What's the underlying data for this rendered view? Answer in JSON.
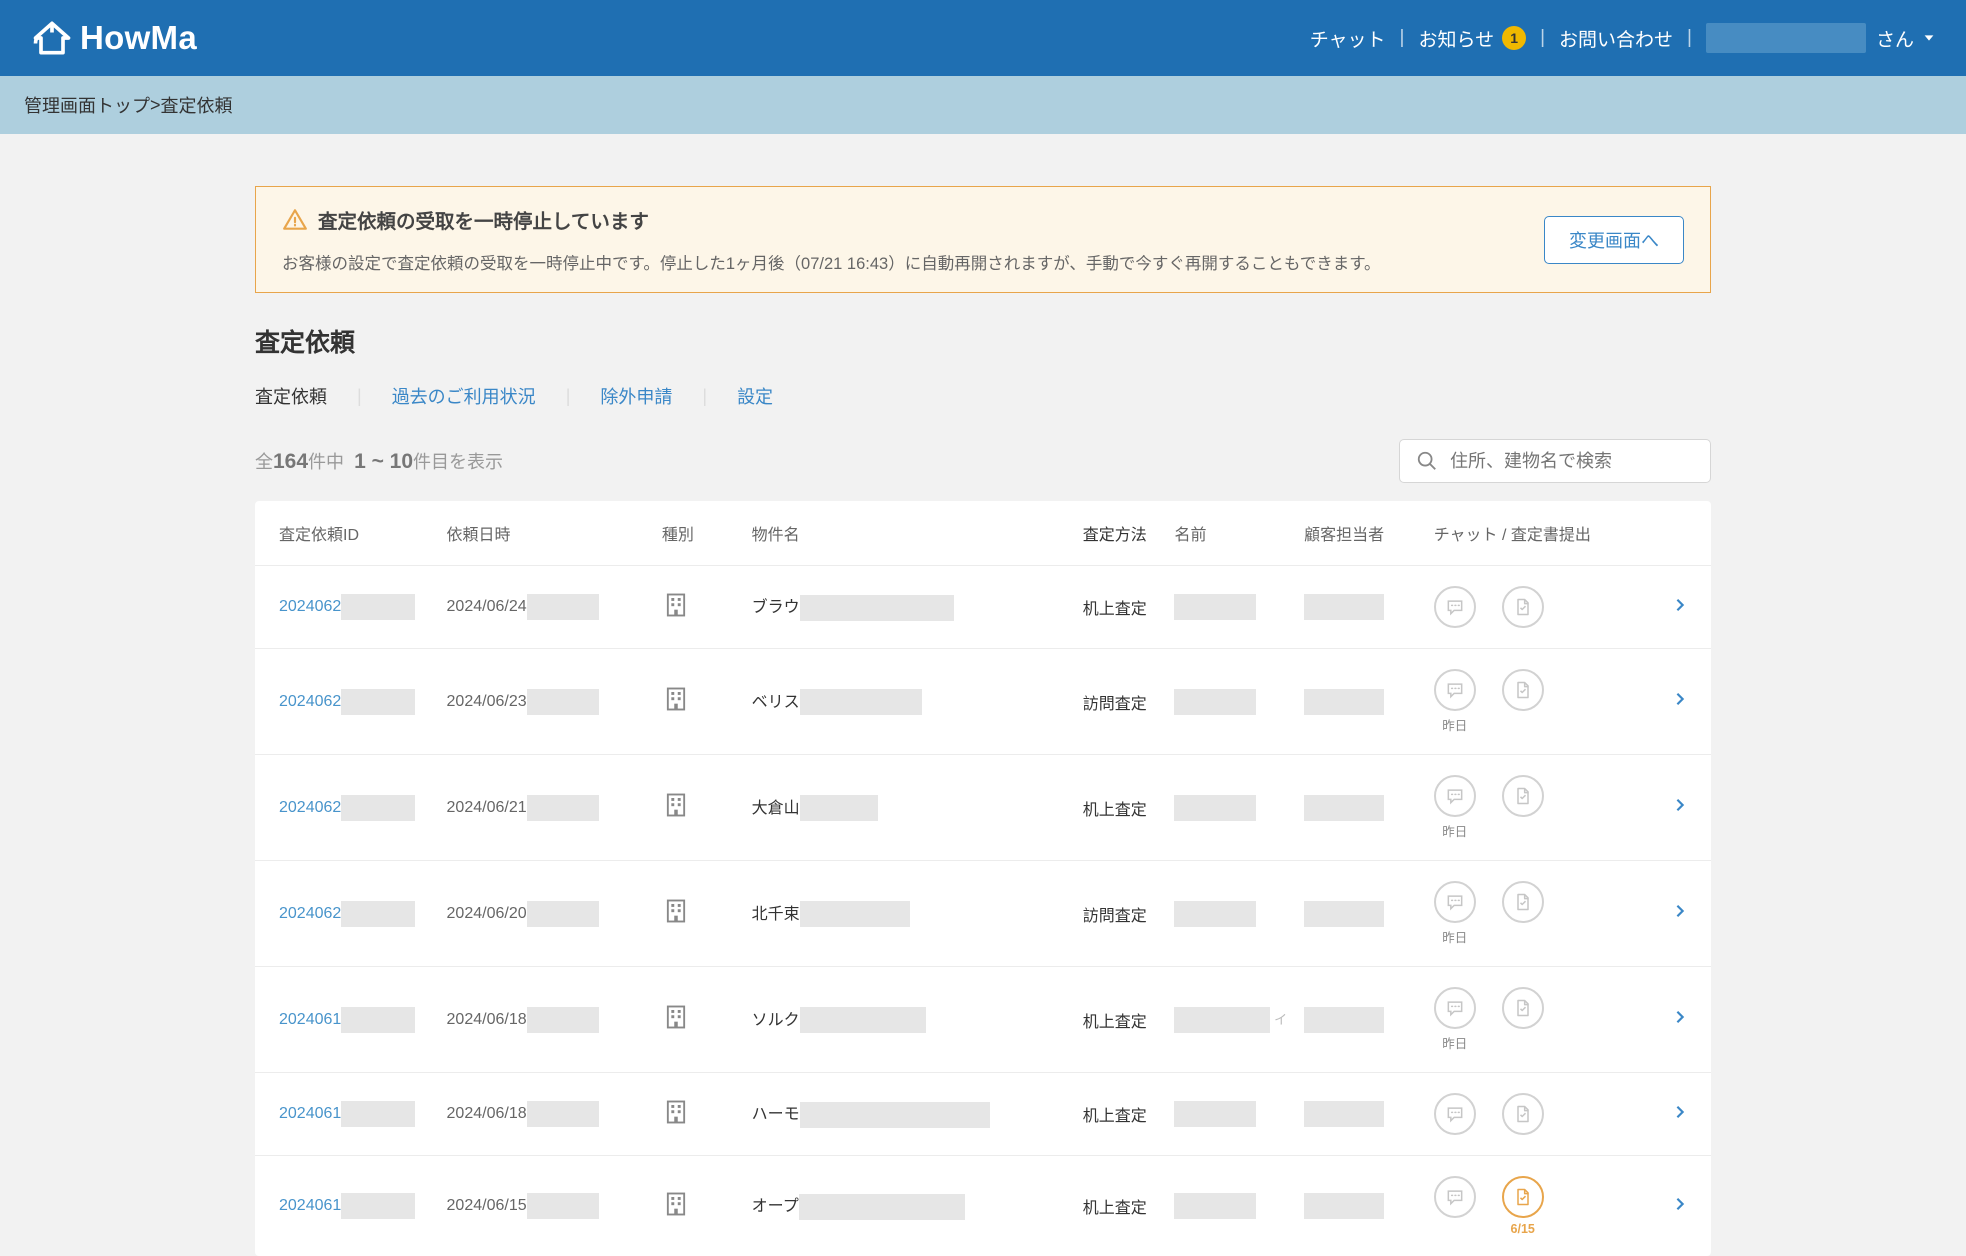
{
  "brand": "HowMa",
  "header_nav": {
    "chat": "チャット",
    "news": "お知らせ",
    "news_badge": "1",
    "contact": "お問い合わせ",
    "user_suffix": "さん"
  },
  "breadcrumb": {
    "top": "管理画面トップ",
    "sep": " > ",
    "current": "査定依頼"
  },
  "alert": {
    "title": "査定依頼の受取を一時停止しています",
    "desc": "お客様の設定で査定依頼の受取を一時停止中です。停止した1ヶ月後（07/21 16:43）に自動再開されますが、手動で今すぐ再開することもできます。",
    "button": "変更画面へ"
  },
  "page_title": "査定依頼",
  "tabs": [
    "査定依頼",
    "過去のご利用状況",
    "除外申請",
    "設定"
  ],
  "count": {
    "prefix": "全",
    "total": "164",
    "mid": "件中",
    "range": "1 ~ 10",
    "suffix": "件目を表示"
  },
  "search_placeholder": "住所、建物名で検索",
  "columns": {
    "id": "査定依頼ID",
    "dt": "依頼日時",
    "typ": "種別",
    "prop": "物件名",
    "meth": "査定方法",
    "name": "名前",
    "rep": "顧客担当者",
    "act": "チャット / 査定書提出"
  },
  "rows": [
    {
      "id": "2024062",
      "dt": "2024/06/24",
      "prop": "ブラウ",
      "prop_w": 204,
      "meth": "机上査定",
      "name_w": 82,
      "rep_w": 80,
      "chat_cap": "",
      "doc_cap": "",
      "doc_hl": false
    },
    {
      "id": "2024062",
      "dt": "2024/06/23",
      "prop": "ベリス",
      "prop_w": 172,
      "meth": "訪問査定",
      "name_w": 82,
      "rep_w": 80,
      "chat_cap": "昨日",
      "doc_cap": "",
      "doc_hl": false
    },
    {
      "id": "2024062",
      "dt": "2024/06/21",
      "prop": "大倉山",
      "prop_w": 128,
      "meth": "机上査定",
      "name_w": 82,
      "rep_w": 80,
      "chat_cap": "昨日",
      "doc_cap": "",
      "doc_hl": false
    },
    {
      "id": "2024062",
      "dt": "2024/06/20",
      "prop": "北千束",
      "prop_w": 160,
      "meth": "訪問査定",
      "name_w": 82,
      "rep_w": 80,
      "chat_cap": "昨日",
      "doc_cap": "",
      "doc_hl": false
    },
    {
      "id": "2024061",
      "dt": "2024/06/18",
      "prop": "ソルク",
      "prop_w": 176,
      "meth": "机上査定",
      "name_w": 96,
      "rep_w": 80,
      "chat_cap": "昨日",
      "doc_cap": "",
      "doc_hl": false,
      "extra": "イ"
    },
    {
      "id": "2024061",
      "dt": "2024/06/18",
      "prop": "ハーモ",
      "prop_w": 240,
      "meth": "机上査定",
      "name_w": 82,
      "rep_w": 80,
      "chat_cap": "",
      "doc_cap": "",
      "doc_hl": false
    },
    {
      "id": "2024061",
      "dt": "2024/06/15",
      "prop": "オープ",
      "prop_w": 216,
      "meth": "机上査定",
      "name_w": 82,
      "rep_w": 80,
      "chat_cap": "",
      "doc_cap": "6/15",
      "doc_hl": true
    }
  ]
}
